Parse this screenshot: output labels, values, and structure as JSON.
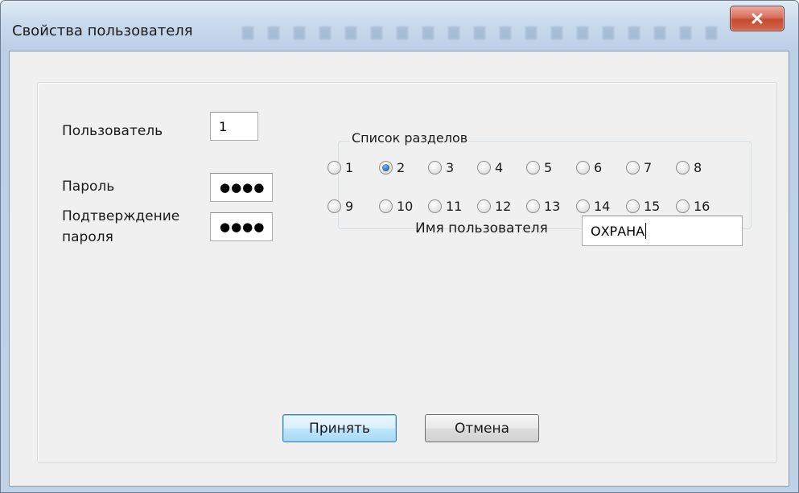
{
  "window": {
    "title": "Свойства пользователя",
    "close_icon": "close-icon"
  },
  "form": {
    "user_label": "Пользователь",
    "user_value": "1",
    "password_label": "Пароль",
    "password_value": "●●●●",
    "confirm_label_line1": "Подтверждение",
    "confirm_label_line2": "пароля",
    "confirm_value": "●●●●",
    "username_label": "Имя пользователя",
    "username_value": "ОХРАНА"
  },
  "partitions": {
    "legend": "Список разделов",
    "items": [
      {
        "label": "1",
        "checked": false
      },
      {
        "label": "2",
        "checked": true
      },
      {
        "label": "3",
        "checked": false
      },
      {
        "label": "4",
        "checked": false
      },
      {
        "label": "5",
        "checked": false
      },
      {
        "label": "6",
        "checked": false
      },
      {
        "label": "7",
        "checked": false
      },
      {
        "label": "8",
        "checked": false
      },
      {
        "label": "9",
        "checked": false
      },
      {
        "label": "10",
        "checked": false
      },
      {
        "label": "11",
        "checked": false
      },
      {
        "label": "12",
        "checked": false
      },
      {
        "label": "13",
        "checked": false
      },
      {
        "label": "14",
        "checked": false
      },
      {
        "label": "15",
        "checked": false
      },
      {
        "label": "16",
        "checked": false
      }
    ]
  },
  "buttons": {
    "accept_label": "Принять",
    "cancel_label": "Отмена"
  },
  "colors": {
    "titlebar": "#c8d9ec",
    "close_button": "#c54a30",
    "client_bg": "#f0f0f0",
    "default_button_border": "#3c7fb1"
  }
}
